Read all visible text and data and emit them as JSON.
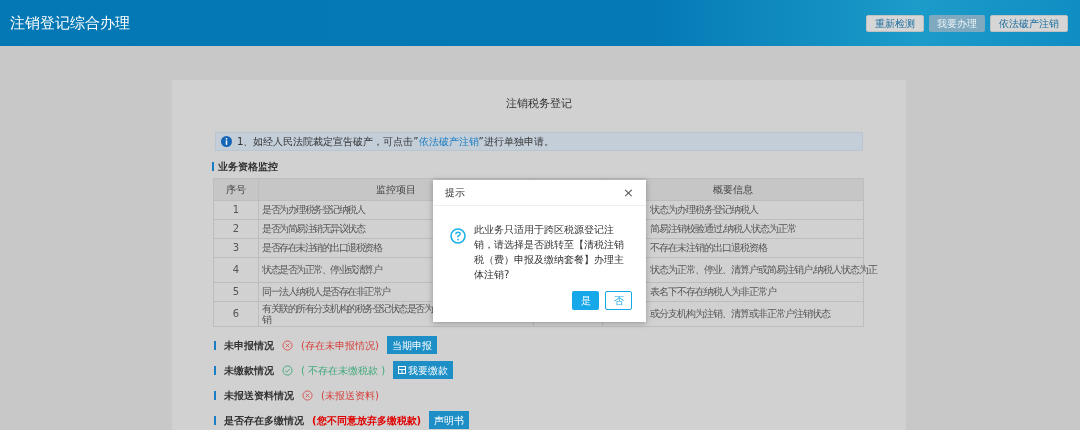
{
  "header": {
    "title": "注销登记综合办理",
    "buttons": [
      {
        "label": "重新检测",
        "disabled": false
      },
      {
        "label": "我要办理",
        "disabled": true
      },
      {
        "label": "依法破产注销",
        "disabled": false
      }
    ]
  },
  "form": {
    "title": "注销税务登记",
    "notice": {
      "before": "1、如经人民法院裁定宣告破产，可点击”",
      "link": "依法破产注销",
      "after": "”进行单独申请。"
    },
    "section_title": "业务资格监控",
    "table": {
      "columns": [
        "序号",
        "监控项目",
        "概要信息"
      ],
      "rows": [
        {
          "no": "1",
          "item": [
            "是否为办理税务登记纳税人"
          ],
          "info": [
            "状态为办理税务登记纳税人"
          ]
        },
        {
          "no": "2",
          "item": [
            "是否为简易注销无异议状态"
          ],
          "info": [
            "简易注销校验通过,纳税人状态为正常"
          ]
        },
        {
          "no": "3",
          "item": [
            "是否存在未注销的出口退税资格"
          ],
          "info": [
            "不存在未注销的出口退税资格"
          ]
        },
        {
          "no": "4",
          "item": [
            "状态是否为正常、停业或清算户"
          ],
          "info": [
            "状态为正常、停业、清算户或简易注销户,纳税人状态为正"
          ]
        },
        {
          "no": "5",
          "item": [
            "同一法人纳税人是否存在非正常户"
          ],
          "info": [
            "表名下不存在纳税人为非正常户"
          ]
        },
        {
          "no": "6",
          "item": [
            "有关联的所有分支机构的税务登记状态是否为",
            "销"
          ],
          "info": [
            "或分支机构为注销、清算或非正常户注销状态"
          ]
        }
      ]
    },
    "checks": [
      {
        "label": "未申报情况",
        "kind": "fail",
        "status": "(存在未申报情况)",
        "button": {
          "label": "当期申报",
          "icon": false
        }
      },
      {
        "label": "未缴款情况",
        "kind": "pass",
        "status": "( 不存在未缴税款 )",
        "button": {
          "label": "我要缴款",
          "icon": true
        }
      },
      {
        "label": "未报送资料情况",
        "kind": "fail",
        "status": "(未报送资料)"
      },
      {
        "label": "是否存在多缴情况",
        "kind": "note",
        "status": "(您不同意放弃多缴税款)",
        "button": {
          "label": "声明书",
          "icon": false
        }
      }
    ]
  },
  "dialog": {
    "title": "提示",
    "close": "×",
    "message": "此业务只适用于跨区税源登记注销，请选择是否跳转至【清税注销税（费）申报及缴纳套餐】办理主体注销?",
    "buttons": [
      {
        "label": "是",
        "primary": true
      },
      {
        "label": "否",
        "primary": false
      }
    ]
  }
}
